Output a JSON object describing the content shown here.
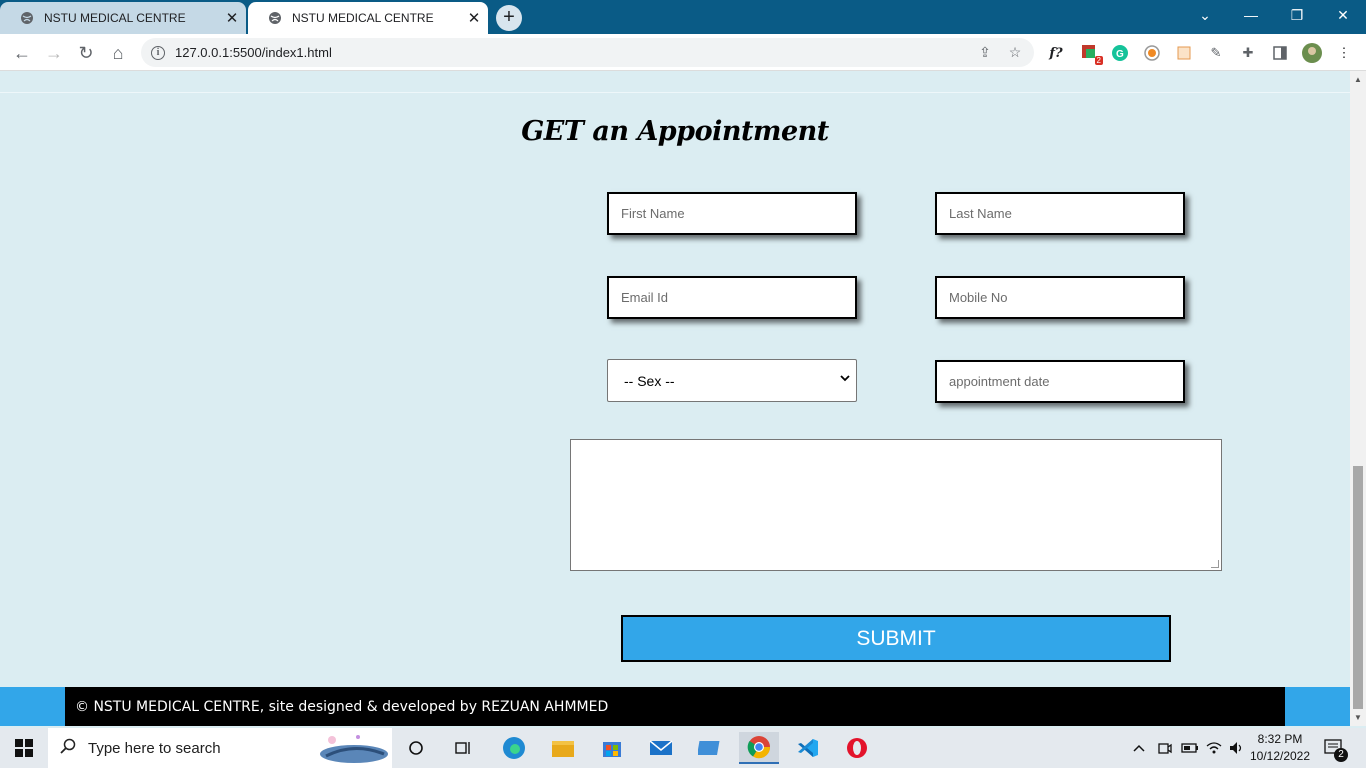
{
  "browser": {
    "tabs": [
      {
        "title": "NSTU MEDICAL CENTRE",
        "active": false
      },
      {
        "title": "NSTU MEDICAL CENTRE",
        "active": true
      }
    ],
    "new_tab": "+",
    "window_controls": {
      "dropdown": "⌄",
      "minimize": "—",
      "restore": "❐",
      "close": "✕"
    },
    "url": "127.0.0.1:5500/index1.html",
    "extensions": [
      "f?"
    ],
    "extension_badge": "2"
  },
  "form": {
    "title": "GET an Appointment",
    "first_name_placeholder": "First Name",
    "last_name_placeholder": "Last Name",
    "email_placeholder": "Email Id",
    "mobile_placeholder": "Mobile No",
    "sex_selected": "-- Sex --",
    "date_placeholder": "appointment date",
    "message_value": "",
    "submit_label": "SUBMIT"
  },
  "footer": {
    "text": "© NSTU MEDICAL CENTRE, site designed & developed by REZUAN AHMMED"
  },
  "taskbar": {
    "search_placeholder": "Type here to search",
    "time": "8:32 PM",
    "date": "10/12/2022",
    "notification_count": "2"
  },
  "colors": {
    "page_bg": "#dbedf2",
    "accent": "#32a6e9",
    "tabbar": "#0a5b86"
  }
}
